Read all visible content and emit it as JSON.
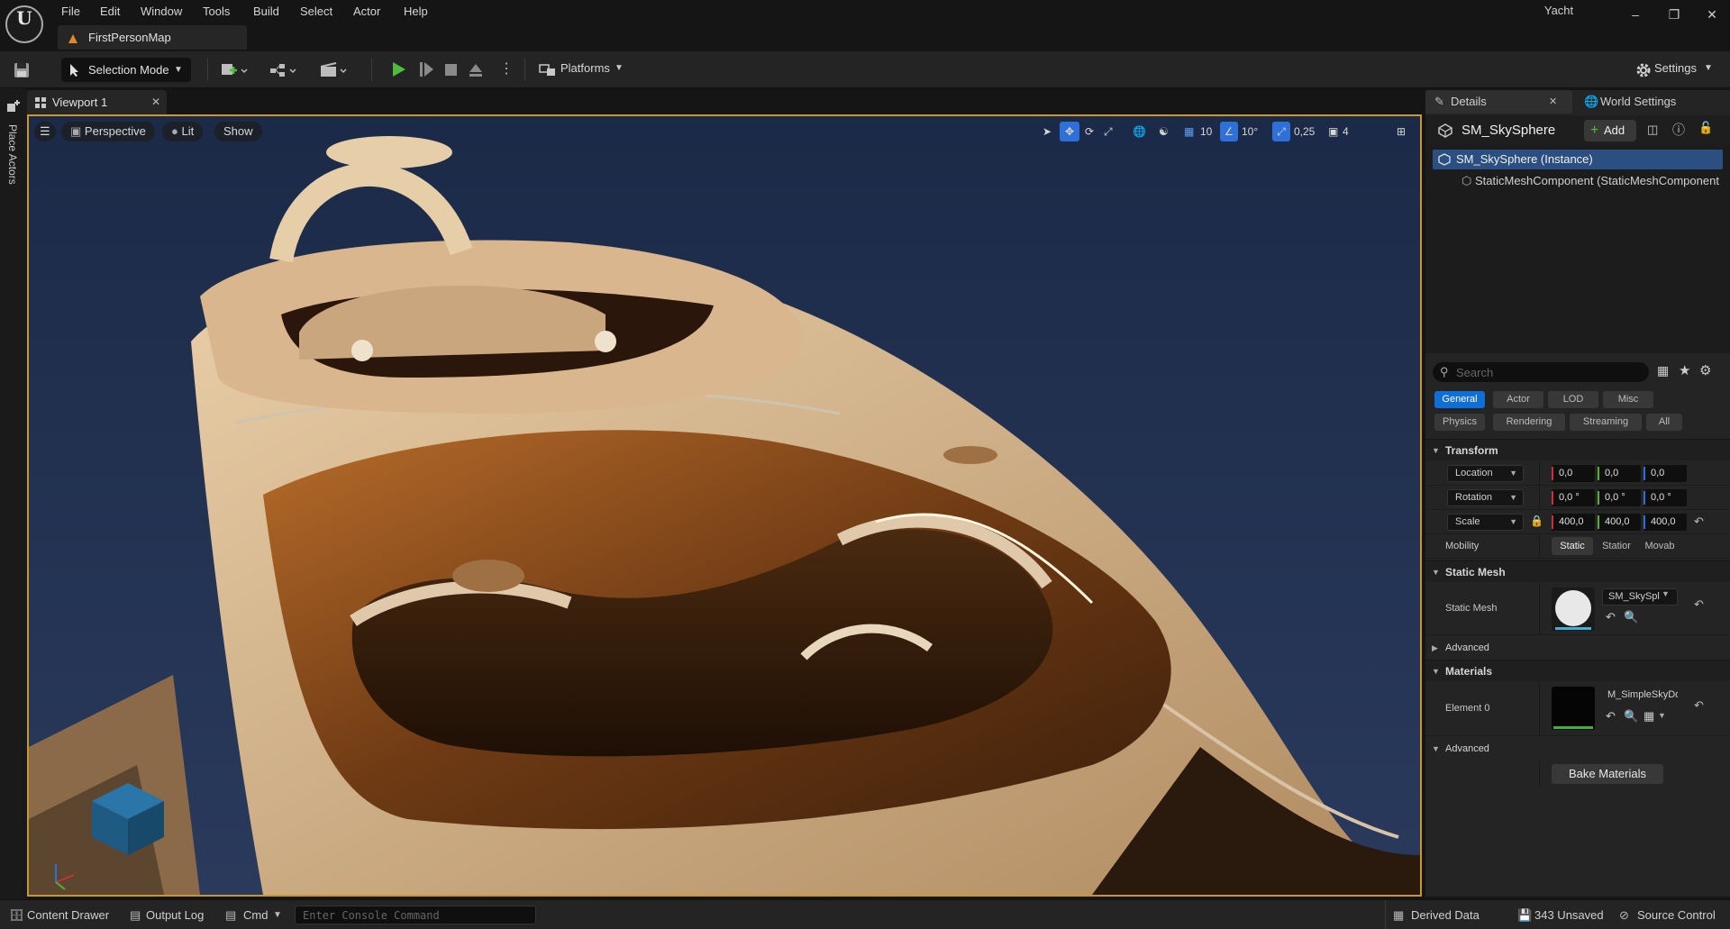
{
  "menu": [
    "File",
    "Edit",
    "Window",
    "Tools",
    "Build",
    "Select",
    "Actor",
    "Help"
  ],
  "map_tab": "FirstPersonMap",
  "project_name": "Yacht",
  "toolbar": {
    "selection_mode": "Selection Mode",
    "platforms": "Platforms",
    "settings": "Settings"
  },
  "left_strip": {
    "place_actors": "Place Actors"
  },
  "viewport": {
    "tab_label": "Viewport 1",
    "perspective": "Perspective",
    "lit": "Lit",
    "show": "Show",
    "grid_snap": "10",
    "rotation_snap": "10°",
    "scale_snap": "0,25",
    "camera_speed": "4"
  },
  "panel": {
    "tab_details": "Details",
    "tab_world_settings": "World Settings",
    "actor_name": "SM_SkySphere",
    "add_label": "Add",
    "tree_row1": "SM_SkySphere (Instance)",
    "tree_row2": "StaticMeshComponent (StaticMeshComponent",
    "search_placeholder": "Search",
    "filters_row1": [
      "General",
      "Actor",
      "LOD",
      "Misc"
    ],
    "filters_row2": [
      "Physics",
      "Rendering",
      "Streaming",
      "All"
    ],
    "transform": {
      "header": "Transform",
      "location_label": "Location",
      "rotation_label": "Rotation",
      "scale_label": "Scale",
      "location": [
        "0,0",
        "0,0",
        "0,0"
      ],
      "rotation": [
        "0,0 °",
        "0,0 °",
        "0,0 °"
      ],
      "scale": [
        "400,0",
        "400,0",
        "400,0"
      ],
      "mobility_label": "Mobility",
      "mobility_options": [
        "Static",
        "Statior",
        "Movab"
      ]
    },
    "static_mesh": {
      "header": "Static Mesh",
      "label": "Static Mesh",
      "asset": "SM_SkySpl",
      "advanced": "Advanced"
    },
    "materials": {
      "header": "Materials",
      "element_label": "Element 0",
      "asset": "M_SimpleSkyDor",
      "advanced": "Advanced",
      "bake_button": "Bake Materials"
    }
  },
  "statusbar": {
    "content_drawer": "Content Drawer",
    "output_log": "Output Log",
    "cmd": "Cmd",
    "console_placeholder": "Enter Console Command",
    "derived_data": "Derived Data",
    "unsaved": "343 Unsaved",
    "source_control": "Source Control"
  },
  "colors": {
    "accent_blue": "#0f6fd6",
    "viewport_border": "#c8972f",
    "axis_x": "#c8303a",
    "axis_y": "#58b030",
    "axis_z": "#2f6fd8",
    "play_green": "#4fbd3c"
  }
}
